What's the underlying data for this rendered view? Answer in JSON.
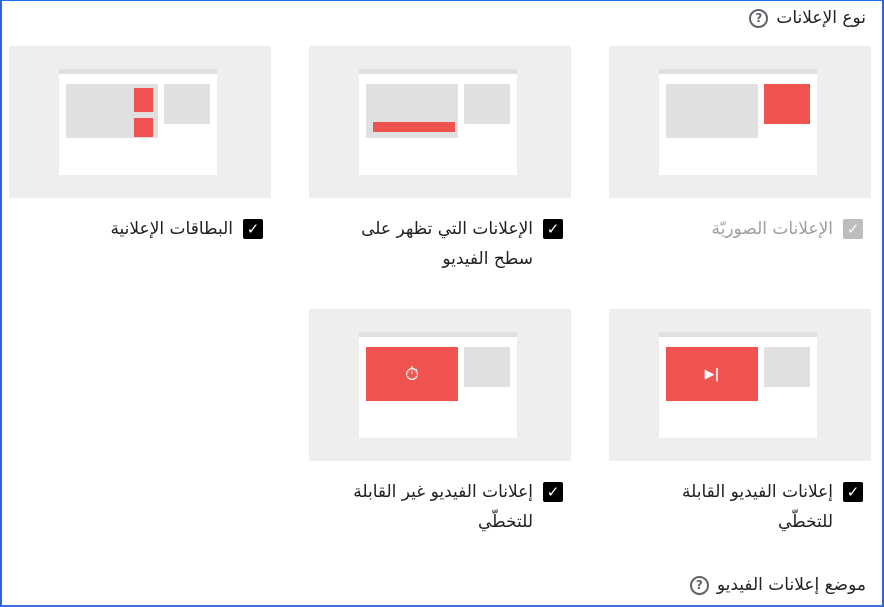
{
  "ad_types": {
    "title": "نوع الإعلانات",
    "help_icon": "?",
    "options": [
      {
        "label": "الإعلانات الصوريّة",
        "checked": true,
        "disabled": true
      },
      {
        "label": "الإعلانات التي تظهر على سطح الفيديو",
        "checked": true,
        "disabled": false
      },
      {
        "label": "البطاقات الإعلانية",
        "checked": true,
        "disabled": false
      },
      {
        "label": "إعلانات الفيديو القابلة للتخطّي",
        "checked": true,
        "disabled": false
      },
      {
        "label": "إعلانات الفيديو غير القابلة للتخطّي",
        "checked": true,
        "disabled": false
      }
    ]
  },
  "video_ad_position": {
    "title": "موضع إعلانات الفيديو",
    "help_icon": "?"
  },
  "icons": {
    "check": "✓",
    "skip": "▶|",
    "timer": "⏱"
  },
  "colors": {
    "accent_red": "#ef5350",
    "frame_blue": "#2b65d9",
    "checkbox": "#000000",
    "checkbox_disabled": "#bdbdbd"
  }
}
